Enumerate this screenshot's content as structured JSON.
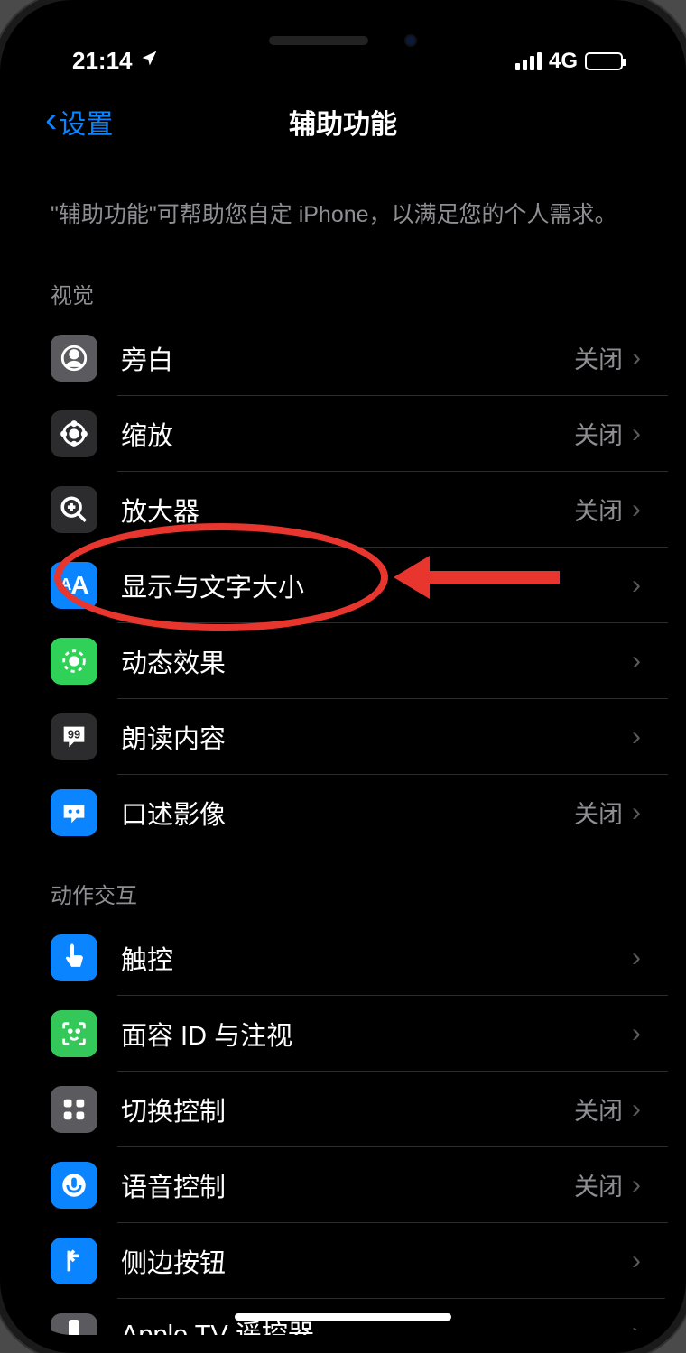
{
  "status": {
    "time": "21:14",
    "network": "4G"
  },
  "nav": {
    "back_label": "设置",
    "title": "辅助功能"
  },
  "description": "\"辅助功能\"可帮助您自定 iPhone，以满足您的个人需求。",
  "sections": {
    "vision": {
      "header": "视觉",
      "items": [
        {
          "label": "旁白",
          "value": "关闭"
        },
        {
          "label": "缩放",
          "value": "关闭"
        },
        {
          "label": "放大器",
          "value": "关闭"
        },
        {
          "label": "显示与文字大小",
          "value": ""
        },
        {
          "label": "动态效果",
          "value": ""
        },
        {
          "label": "朗读内容",
          "value": ""
        },
        {
          "label": "口述影像",
          "value": "关闭"
        }
      ]
    },
    "motor": {
      "header": "动作交互",
      "items": [
        {
          "label": "触控",
          "value": ""
        },
        {
          "label": "面容 ID 与注视",
          "value": ""
        },
        {
          "label": "切换控制",
          "value": "关闭"
        },
        {
          "label": "语音控制",
          "value": "关闭"
        },
        {
          "label": "侧边按钮",
          "value": ""
        },
        {
          "label": "Apple TV 遥控器",
          "value": ""
        }
      ]
    }
  },
  "annotation": {
    "highlighted_item": "显示与文字大小"
  }
}
